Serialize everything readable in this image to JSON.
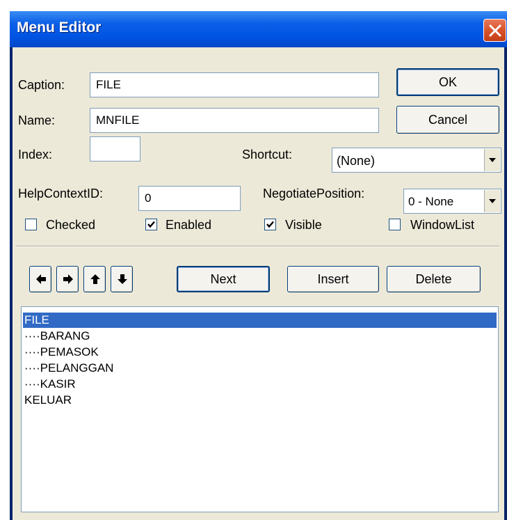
{
  "window": {
    "title": "Menu Editor"
  },
  "form": {
    "caption_label": "Caption:",
    "caption_value": "FILE",
    "name_label": "Name:",
    "name_value": "MNFILE",
    "index_label": "Index:",
    "index_value": "",
    "shortcut_label": "Shortcut:",
    "shortcut_value": "(None)",
    "helpcontext_label": "HelpContextID:",
    "helpcontext_value": "0",
    "negotiate_label": "NegotiatePosition:",
    "negotiate_value": "0 - None"
  },
  "checkboxes": [
    {
      "label": "Checked",
      "checked": false
    },
    {
      "label": "Enabled",
      "checked": true
    },
    {
      "label": "Visible",
      "checked": true
    },
    {
      "label": "WindowList",
      "checked": false
    }
  ],
  "buttons": {
    "ok": "OK",
    "cancel": "Cancel",
    "next": "Next",
    "insert": "Insert",
    "delete": "Delete"
  },
  "arrow_buttons": [
    "left-arrow-icon",
    "right-arrow-icon",
    "up-arrow-icon",
    "down-arrow-icon"
  ],
  "menu_items": [
    {
      "text": "FILE",
      "selected": true
    },
    {
      "text": "····BARANG",
      "selected": false
    },
    {
      "text": "····PEMASOK",
      "selected": false
    },
    {
      "text": "····PELANGGAN",
      "selected": false
    },
    {
      "text": "····KASIR",
      "selected": false
    },
    {
      "text": "KELUAR",
      "selected": false
    }
  ],
  "colors": {
    "titlebar": "#0054E3",
    "selection": "#316AC5",
    "dialog_bg": "#ECE9D8",
    "close_button": "#D9532C"
  }
}
